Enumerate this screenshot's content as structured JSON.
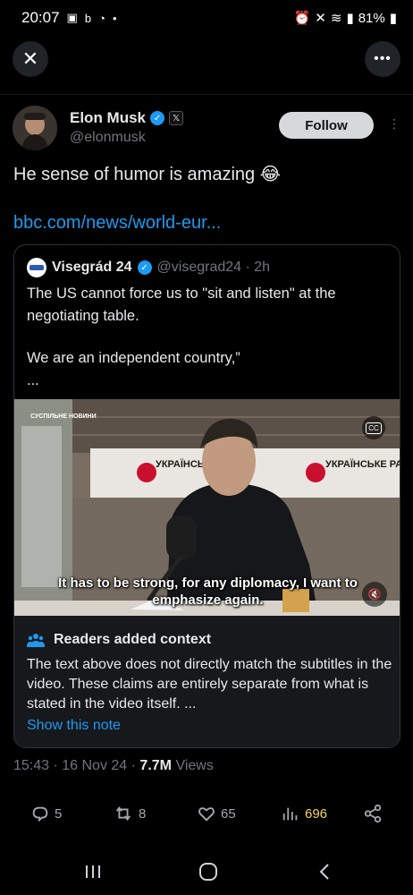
{
  "status_bar": {
    "time": "20:07",
    "battery": "81%"
  },
  "author": {
    "name": "Elon Musk",
    "handle": "@elonmusk",
    "follow_label": "Follow"
  },
  "tweet": {
    "text": "He sense of humor is amazing 😂",
    "link": "bbc.com/news/world-eur..."
  },
  "quote": {
    "name": "Visegrád 24",
    "handle_time": "@visegrad24 · 2h",
    "line1": "The US cannot force us to \"sit and listen\" at the",
    "line2": "negotiating table.",
    "line3": "We are an independent country,”",
    "line4": "..."
  },
  "video": {
    "brand": "СУСПІЛЬНЕ НОВИНИ",
    "sign1": "УКРАЇНСЬКЕ РАДІО",
    "sign2": "УКРАЇНСЬКЕ РАДІО",
    "subtitle_line1": "It has to be strong, for any diplomacy, I want to",
    "subtitle_line2": "emphasize again."
  },
  "context": {
    "title": "Readers added context",
    "body": "The text above does not directly match the subtitles in the video. These claims are entirely separate from what is stated in the video itself. ...",
    "show_note": "Show this note"
  },
  "meta": {
    "time_date": "15:43 · 16 Nov 24 · ",
    "views_count": "7.7M",
    "views_label": " Views"
  },
  "actions": {
    "replies": "5",
    "reposts": "8",
    "likes": "65",
    "views": "696"
  },
  "colors": {
    "accent": "#1d9bf0",
    "views_highlight": "#f4d35e"
  }
}
